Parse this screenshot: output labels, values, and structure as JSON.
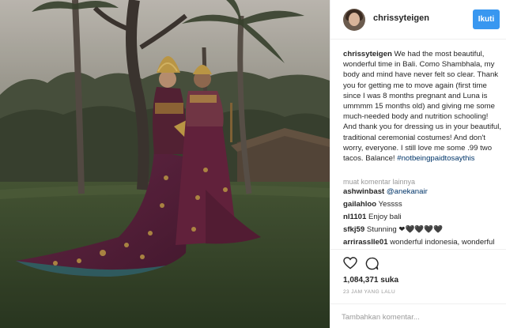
{
  "post": {
    "image_alt": "Couple in traditional Balinese ceremonial costumes standing on a lawn among palm trees"
  },
  "header": {
    "username": "chrissyteigen",
    "follow_label": "Ikuti"
  },
  "caption": {
    "username": "chrissyteigen",
    "text": " We had the most beautiful, wonderful time in Bali. Como Shambhala, my body and mind have never felt so clear. Thank you for getting me to move again (first time since I was 8 months pregnant and Luna is ummmm 15 months old) and giving me some much-needed body and nutrition schooling! And thank you for dressing us in your beautiful, traditional ceremonial costumes! And don't worry, everyone. I still love me some .99 two tacos. Balance! ",
    "hashtag": "#notbeingpaidtosaythis"
  },
  "comments_section": {
    "load_more_label": "muat komentar lainnya",
    "items": [
      {
        "user": "ashwinbast",
        "text": "",
        "mention": "@anekanair"
      },
      {
        "user": "gailahloo",
        "text": "Yessss",
        "mention": ""
      },
      {
        "user": "nl1101",
        "text": "Enjoy bali",
        "mention": ""
      },
      {
        "user": "sfkj59",
        "text": "Stunning ❤🖤🖤🖤🖤",
        "mention": ""
      },
      {
        "user": "arrirasslle01",
        "text": "wonderful indonesia, wonderful",
        "mention": ""
      }
    ]
  },
  "actions": {
    "heart_icon": "heart-outline-icon",
    "comment_icon": "comment-bubble-icon",
    "likes_text": "1,084,371 suka",
    "timestamp": "23 JAM YANG LALU",
    "add_comment_placeholder": "Tambahkan komentar..."
  },
  "colors": {
    "accent": "#3897f0",
    "link": "#003569",
    "muted": "#999999",
    "border": "#efefef"
  }
}
